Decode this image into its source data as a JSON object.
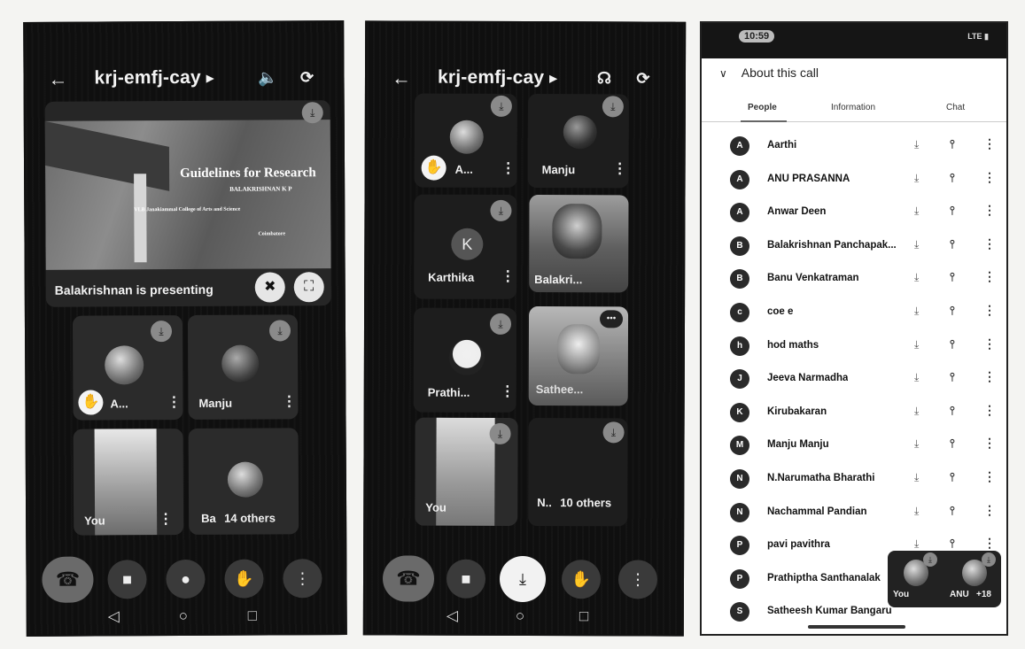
{
  "meeting": {
    "code": "krj-emfj-cay"
  },
  "phone1": {
    "presentation": {
      "slide_title": "Guidelines for Research",
      "slide_author": "BALAKRISHNAN K P",
      "slide_line2": "VLB Janakiammal College of Arts and Science",
      "slide_line3": "Coimbatore",
      "presenting_label": "Balakrishnan is presenting"
    },
    "tiles": [
      {
        "name": "A..."
      },
      {
        "name": "Manju"
      },
      {
        "name": "You"
      },
      {
        "name": "Ba",
        "others": "14 others"
      }
    ]
  },
  "phone2": {
    "tiles": [
      {
        "name": "A..."
      },
      {
        "name": "Manju"
      },
      {
        "name": "Karthika",
        "initial": "K"
      },
      {
        "name": "Balakri..."
      },
      {
        "name": "Prathi..."
      },
      {
        "name": "Sathee..."
      },
      {
        "name": "You"
      },
      {
        "name": "N..",
        "others": "10 others"
      }
    ]
  },
  "phone3": {
    "status_time": "10:59",
    "signal": "LTE",
    "about_label": "About this call",
    "tabs": [
      "People",
      "Information",
      "Chat"
    ],
    "people": [
      {
        "name": "Aarthi",
        "initial": "A"
      },
      {
        "name": "ANU PRASANNA",
        "initial": "A"
      },
      {
        "name": "Anwar Deen",
        "initial": "A"
      },
      {
        "name": "Balakrishnan Panchapak...",
        "initial": "B"
      },
      {
        "name": "Banu Venkatraman",
        "initial": "B"
      },
      {
        "name": "coe e",
        "initial": "c"
      },
      {
        "name": "hod maths",
        "initial": "h"
      },
      {
        "name": "Jeeva Narmadha",
        "initial": "J"
      },
      {
        "name": "Kirubakaran",
        "initial": "K"
      },
      {
        "name": "Manju Manju",
        "initial": "M"
      },
      {
        "name": "N.Narumatha Bharathi",
        "initial": "N"
      },
      {
        "name": "Nachammal Pandian",
        "initial": "N"
      },
      {
        "name": "pavi pavithra",
        "initial": "P"
      },
      {
        "name": "Prathiptha Santhanalak",
        "initial": "P"
      },
      {
        "name": "Satheesh Kumar Bangaru",
        "initial": "S"
      }
    ],
    "mini": {
      "you": "You",
      "other": "ANU",
      "more": "+18"
    }
  },
  "icons": {
    "back": "arrow-left-icon",
    "volume": "speaker-icon",
    "switch": "camera-switch-icon",
    "headphones": "headphones-icon",
    "end_call": "phone-hangup-icon",
    "camera": "video-camera-icon",
    "mic": "microphone-icon",
    "hand": "raise-hand-icon",
    "more": "more-vertical-icon",
    "mic_off": "mic-off-icon",
    "pin": "pin-icon"
  }
}
